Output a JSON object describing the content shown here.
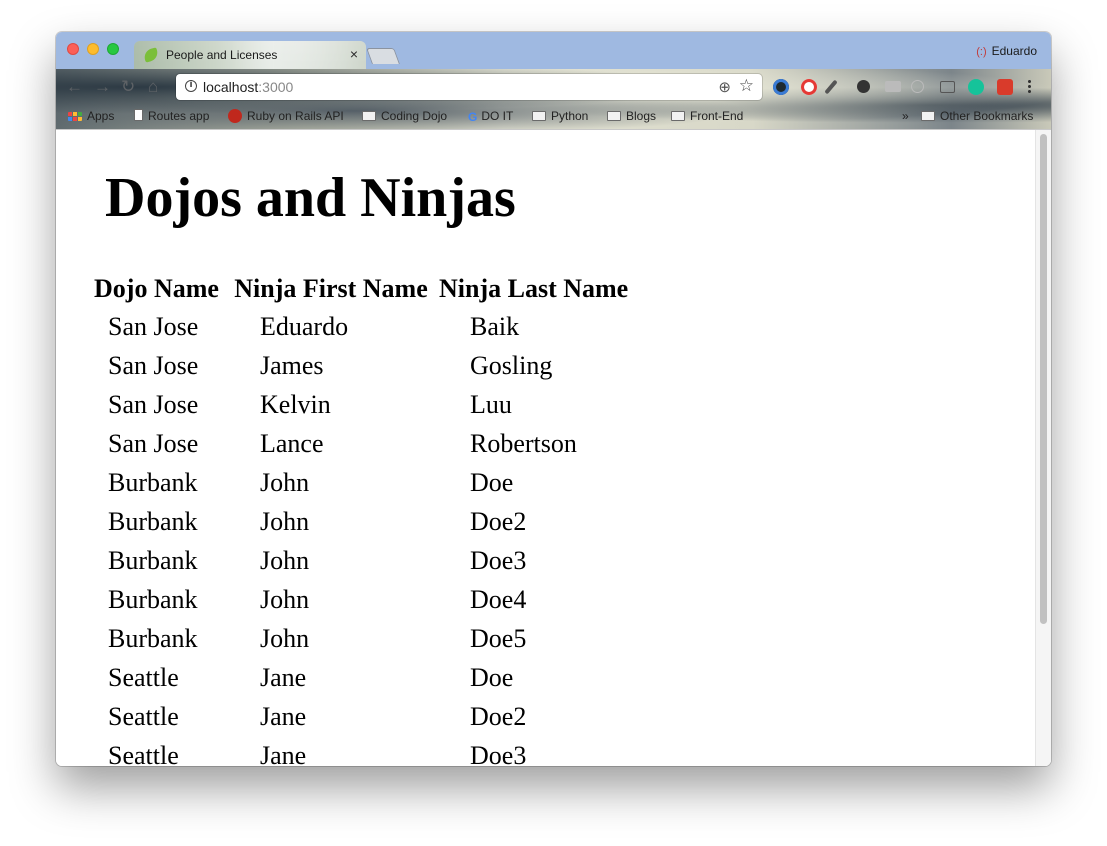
{
  "browser": {
    "tab_title": "People and Licenses",
    "tab_close": "×",
    "profile_name": "Eduardo",
    "profile_icon": "(:)",
    "url_host": "localhost",
    "url_port": ":3000",
    "nav": {
      "back": "←",
      "forward": "→",
      "reload": "↻",
      "home": "⌂"
    },
    "bookmarks": [
      "Apps",
      "Routes app",
      "Ruby on Rails API",
      "Coding Dojo",
      "DO IT",
      "Python",
      "Blogs",
      "Front-End"
    ],
    "bookmarks_overflow": "»",
    "other_bookmarks": "Other Bookmarks"
  },
  "page": {
    "title": "Dojos and Ninjas",
    "columns": [
      "Dojo Name",
      "Ninja First Name",
      "Ninja Last Name"
    ],
    "rows": [
      [
        "San Jose",
        "Eduardo",
        "Baik"
      ],
      [
        "San Jose",
        "James",
        "Gosling"
      ],
      [
        "San Jose",
        "Kelvin",
        "Luu"
      ],
      [
        "San Jose",
        "Lance",
        "Robertson"
      ],
      [
        "Burbank",
        "John",
        "Doe"
      ],
      [
        "Burbank",
        "John",
        "Doe2"
      ],
      [
        "Burbank",
        "John",
        "Doe3"
      ],
      [
        "Burbank",
        "John",
        "Doe4"
      ],
      [
        "Burbank",
        "John",
        "Doe5"
      ],
      [
        "Seattle",
        "Jane",
        "Doe"
      ],
      [
        "Seattle",
        "Jane",
        "Doe2"
      ],
      [
        "Seattle",
        "Jane",
        "Doe3"
      ]
    ]
  }
}
